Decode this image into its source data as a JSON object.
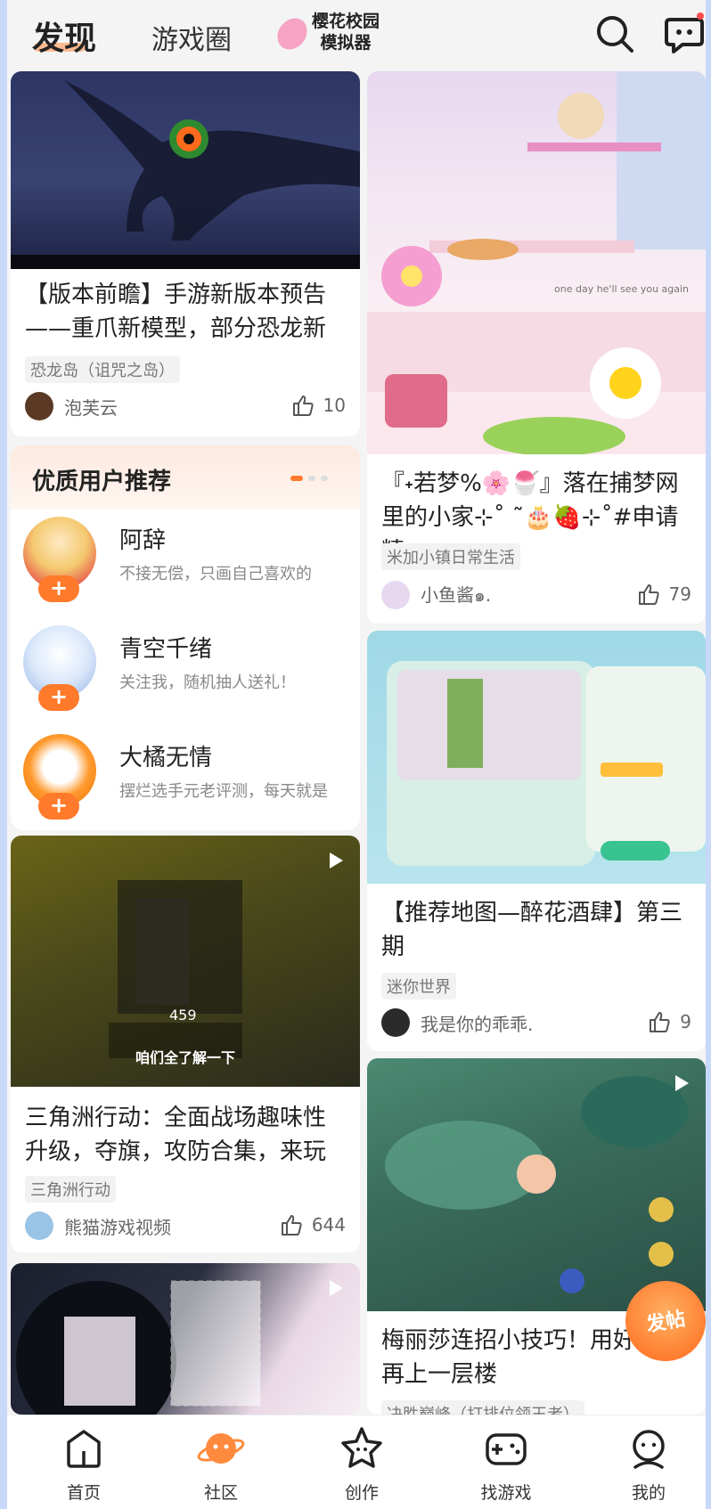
{
  "header": {
    "tabs": [
      {
        "label": "发现"
      },
      {
        "label": "游戏圈"
      }
    ],
    "logo_text": "樱花校园模拟器"
  },
  "feed": {
    "left": [
      {
        "title": "【版本前瞻】手游新版本预告——重爪新模型，部分恐龙新",
        "tag": "恐龙岛（诅咒之岛）",
        "author": "泡芙云",
        "likes": "10"
      },
      {
        "title": "三角洲行动：全面战场趣味性升级，夺旗，攻防合集，来玩",
        "tag": "三角洲行动",
        "author": "熊猫游戏视频",
        "likes": "644",
        "overlay_text": "咱们全了解一下",
        "overlay_num": "459"
      }
    ],
    "right": [
      {
        "title": "『˖若梦%🌸🍧』落在捕梦网里的小家⊹˚ ˜🎂🍓⊹˚#申请精",
        "tag": "米加小镇日常生活",
        "author": "小鱼酱๑.",
        "likes": "79",
        "image_caption": "one day he'll see you again"
      },
      {
        "title": "【推荐地图—醉花酒肆】第三期",
        "tag": "迷你世界",
        "author": "我是你的乖乖.",
        "likes": "9"
      },
      {
        "title": "梅丽莎连招小技巧！用好伤害再上一层楼",
        "tag": "决胜巅峰（打排位领王者）"
      }
    ]
  },
  "recommend": {
    "title": "优质用户推荐",
    "users": [
      {
        "name": "阿辞",
        "desc": "不接无偿，只画自己喜欢的"
      },
      {
        "name": "青空千绪",
        "desc": "关注我，随机抽人送礼！"
      },
      {
        "name": "大橘无情",
        "desc": "摆烂选手元老评测，每天就是"
      }
    ],
    "plus": "+"
  },
  "fab_label": "发帖",
  "bottom_nav": [
    {
      "label": "首页",
      "icon": "home-icon"
    },
    {
      "label": "社区",
      "icon": "planet-icon"
    },
    {
      "label": "创作",
      "icon": "star-icon"
    },
    {
      "label": "找游戏",
      "icon": "gamepad-icon"
    },
    {
      "label": "我的",
      "icon": "profile-icon"
    }
  ],
  "colors": {
    "accent": "#ff7a2a",
    "background": "#f4f4f4"
  }
}
